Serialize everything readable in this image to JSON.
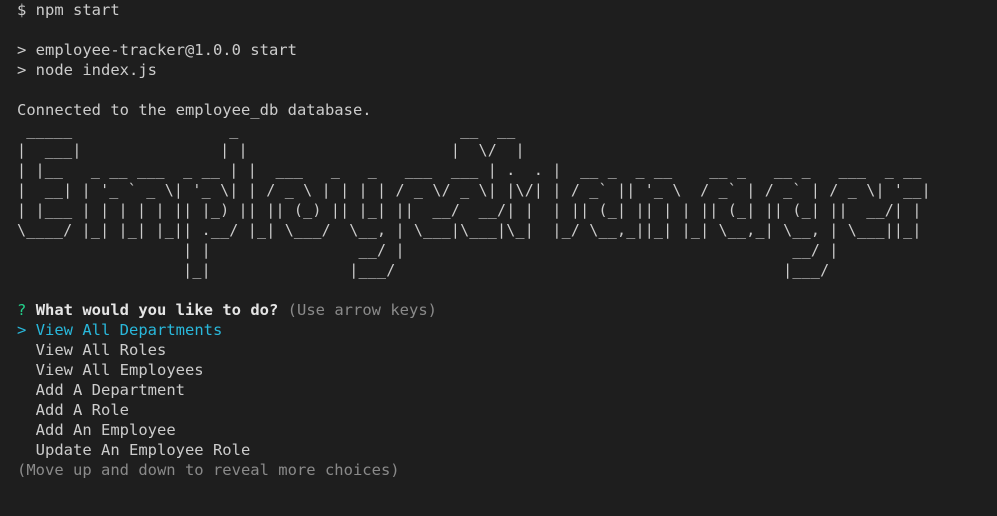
{
  "terminal": {
    "command_line": "$ npm start",
    "npm_output": [
      "> employee-tracker@1.0.0 start",
      "> node index.js"
    ],
    "connection_message": "Connected to the employee_db database.",
    "banner_ascii": " _____                 _                        __  __\n|  ___|               | |                      |  \\/  |\n| |__   _ __ ___  _ __ | |  ___   _   _   ___  ___ | .  . |  __ _  _ __    __ _   __ _   ___  _ __\n|  __| | '_ ` _ \\| '_ \\| | / _ \\ | | | | / _ \\/ _ \\| |\\/| | / _` || '_ \\  / _` | / _` | / _ \\| '__|\n| |___ | | | | | || |_) || || (_) || |_| ||  __/  __/| |  | || (_| || | | || (_| || (_| ||  __/| |\n\\____/ |_| |_| |_|| .__/ |_| \\___/  \\__, | \\___|\\___|\\_|  |_/ \\__,_||_| |_| \\__,_| \\__, | \\___||_|\n                  | |                __/ |                                          __/ |\n                  |_|               |___/                                          |___/",
    "prompt": {
      "marker": "?",
      "question": "What would you like to do?",
      "hint": "(Use arrow keys)",
      "pointer": ">",
      "choices": [
        "View All Departments",
        "View All Roles",
        "View All Employees",
        "Add A Department",
        "Add A Role",
        "Add An Employee",
        "Update An Employee Role"
      ],
      "selected_index": 0,
      "footer": "(Move up and down to reveal more choices)"
    }
  },
  "colors": {
    "background": "#1e1e1e",
    "text": "#cccccc",
    "prompt_marker": "#23d18b",
    "selected_choice": "#29b8db",
    "hint": "#8a8a8a"
  }
}
